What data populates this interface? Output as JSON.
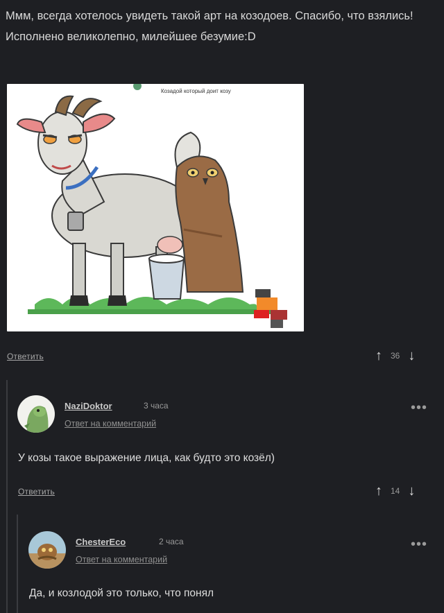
{
  "top_comment": {
    "text": "Ммм, всегда хотелось увидеть такой арт на козодоев. Спасибо, что взялись! Исполнено великолепно, милейшее безумие:D",
    "image_caption": "Козадой который доит козу",
    "reply_label": "Ответить",
    "votes": "36"
  },
  "reply1": {
    "username": "NaziDoktor",
    "time": "3 часа",
    "reply_to": "Ответ на комментарий",
    "text": "У козы такое выражение лица, как будто это козёл)",
    "reply_label": "Ответить",
    "votes": "14",
    "more": "•••"
  },
  "reply2": {
    "username": "ChesterEco",
    "time": "2 часа",
    "reply_to": "Ответ на комментарий",
    "text": "Да, и козлодой это только, что понял",
    "more": "•••"
  },
  "icons": {
    "upvote": "↑",
    "downvote": "↓"
  }
}
